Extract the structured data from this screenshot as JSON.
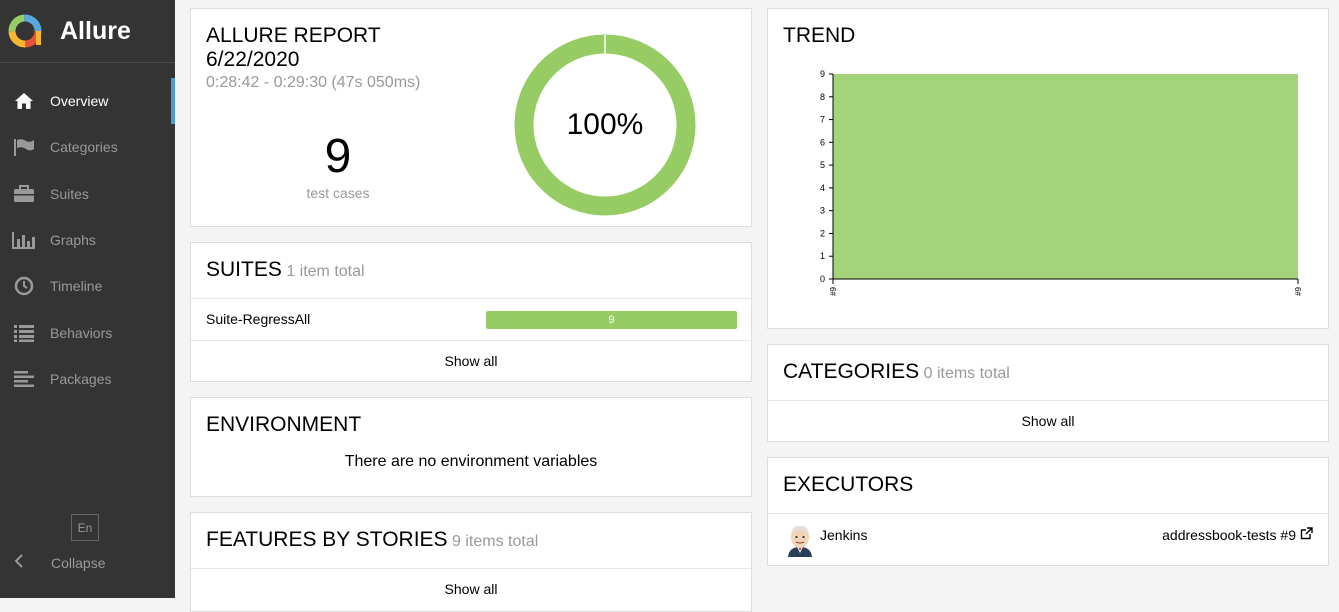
{
  "brand": {
    "name": "Allure"
  },
  "nav": {
    "items": [
      {
        "label": "Overview",
        "icon": "home-icon",
        "active": true
      },
      {
        "label": "Categories",
        "icon": "flag-icon"
      },
      {
        "label": "Suites",
        "icon": "briefcase-icon"
      },
      {
        "label": "Graphs",
        "icon": "bar-chart-icon"
      },
      {
        "label": "Timeline",
        "icon": "clock-icon"
      },
      {
        "label": "Behaviors",
        "icon": "list-icon"
      },
      {
        "label": "Packages",
        "icon": "align-left-icon"
      }
    ],
    "language": "En",
    "collapse": "Collapse"
  },
  "summary": {
    "title": "ALLURE REPORT",
    "date": "6/22/2020",
    "time_range": "0:28:42 - 0:29:30 (47s 050ms)",
    "test_count": "9",
    "test_count_label": "test cases",
    "pass_rate": "100%",
    "pass_fraction": 1.0
  },
  "suites": {
    "title": "SUITES",
    "subtitle": "1 item total",
    "rows": [
      {
        "name": "Suite-RegressAll",
        "value": "9"
      }
    ],
    "show_all": "Show all"
  },
  "environment": {
    "title": "ENVIRONMENT",
    "message": "There are no environment variables"
  },
  "features": {
    "title": "FEATURES BY STORIES",
    "subtitle": "9 items total",
    "show_all": "Show all"
  },
  "trend": {
    "title": "TREND"
  },
  "chart_data": {
    "type": "area",
    "x": [
      "#9",
      "#9"
    ],
    "series": [
      {
        "values": [
          9,
          9
        ],
        "color": "#a3d37a"
      }
    ],
    "ylim": [
      0,
      9
    ],
    "yticks": [
      "0",
      "1",
      "2",
      "3",
      "4",
      "5",
      "6",
      "7",
      "8",
      "9"
    ],
    "grid": false
  },
  "categories": {
    "title": "CATEGORIES",
    "subtitle": "0 items total",
    "show_all": "Show all"
  },
  "executors": {
    "title": "EXECUTORS",
    "name": "Jenkins",
    "build": "addressbook-tests #9"
  },
  "colors": {
    "passed": "#97cc64",
    "sidebar": "#343434",
    "accent": "#4b9cd3"
  }
}
